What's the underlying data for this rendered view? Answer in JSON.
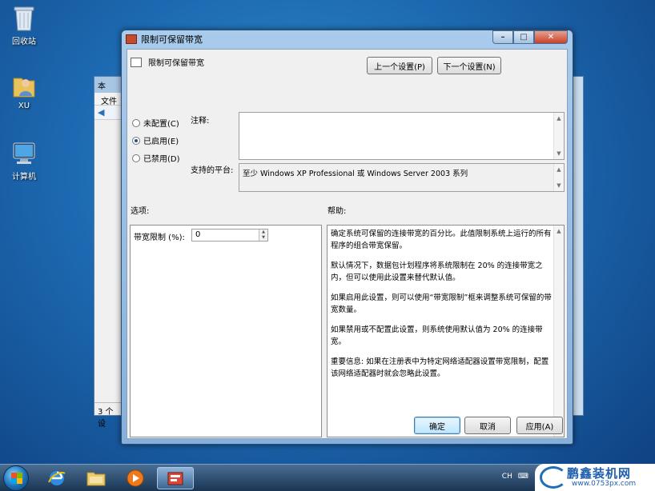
{
  "desktop": {
    "icons": [
      {
        "label": "回收站"
      },
      {
        "label": "XU"
      },
      {
        "label": "计算机"
      }
    ]
  },
  "bg_window": {
    "title": "本",
    "menu": "文件",
    "status": "3 个设"
  },
  "dialog": {
    "title": "限制可保留带宽",
    "header": "限制可保留带宽",
    "prev_button": "上一个设置(P)",
    "next_button": "下一个设置(N)",
    "radios": [
      {
        "label": "未配置(C)",
        "selected": false
      },
      {
        "label": "已启用(E)",
        "selected": true
      },
      {
        "label": "已禁用(D)",
        "selected": false
      }
    ],
    "comment_label": "注释:",
    "comment_value": "",
    "platform_label": "支持的平台:",
    "platform_value": "至少 Windows XP Professional 或 Windows Server 2003 系列",
    "options_label": "选项:",
    "help_label": "帮助:",
    "option": {
      "label": "带宽限制 (%):",
      "value": "0"
    },
    "help": [
      "确定系统可保留的连接带宽的百分比。此值限制系统上运行的所有程序的组合带宽保留。",
      "默认情况下，数据包计划程序将系统限制在 20% 的连接带宽之内，但可以使用此设置来替代默认值。",
      "如果启用此设置，则可以使用“带宽限制”框来调整系统可保留的带宽数量。",
      "如果禁用或不配置此设置，则系统使用默认值为 20% 的连接带宽。",
      "重要信息: 如果在注册表中为特定网络适配器设置带宽限制，配置该网络适配器时就会忽略此设置。"
    ],
    "ok_button": "确定",
    "cancel_button": "取消",
    "apply_button": "应用(A)"
  },
  "taskbar": {
    "tray": "CH"
  },
  "watermark": {
    "name": "鹏鑫装机网",
    "url": "www.0753px.com"
  }
}
